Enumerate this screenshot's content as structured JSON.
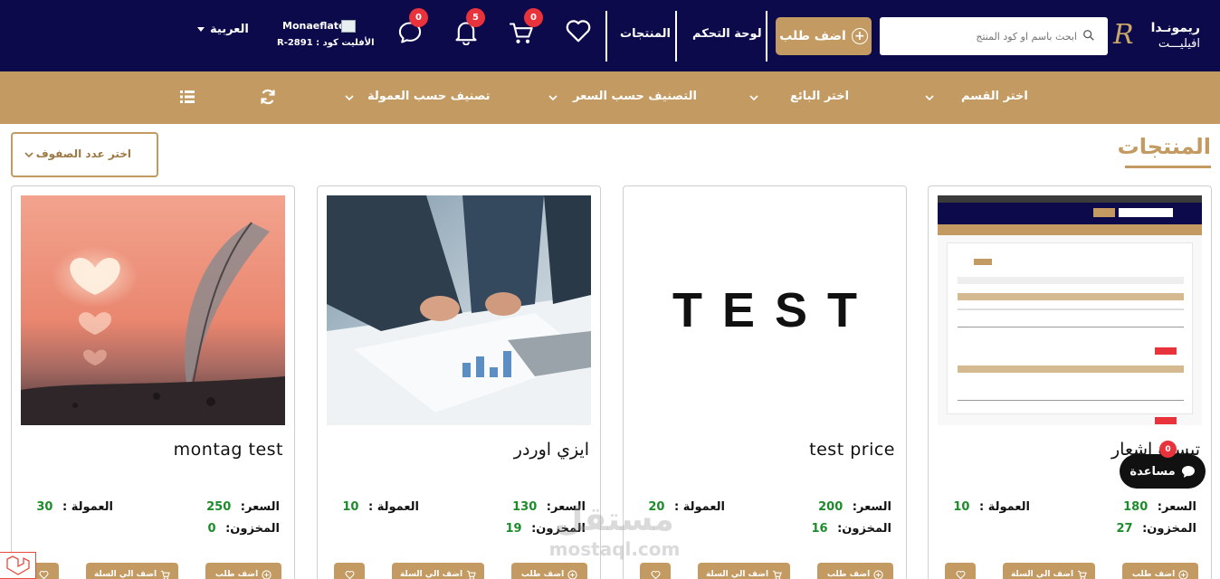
{
  "header": {
    "brand_line1": "ريمونـدا",
    "brand_line2": "افيليـــت",
    "brand_mono": "R",
    "search_placeholder": "ابحث باسم او كود المنتج",
    "add_order": "اضف طلب",
    "nav_dashboard": "لوحة التحكم",
    "nav_products": "المنتجات",
    "cart_count": "0",
    "notifications_count": "5",
    "messages_count": "0",
    "user_name": "Monaeflate",
    "user_code": "الأفليت كود : R-2891",
    "language": "العربية"
  },
  "filters": {
    "category": "اختر القسم",
    "seller": "اختر البائع",
    "price_sort": "التصنيف حسب السعر",
    "commission_sort": "تصنيف حسب العمولة"
  },
  "section": {
    "title": "المنتجات",
    "rows_select": "اختر عدد الصفوف"
  },
  "labels": {
    "price": "السعر:",
    "commission": "العمولة :",
    "stock": "المخزون:",
    "add_order_btn": "اضف طلب",
    "add_cart_btn": "اضف الي السلة"
  },
  "products": [
    {
      "name": "تيست اشعار",
      "price": "180",
      "commission": "10",
      "stock": "27",
      "image": "screenshot"
    },
    {
      "name": "test price",
      "price": "200",
      "commission": "20",
      "stock": "16",
      "image": "text",
      "image_text": "TEST"
    },
    {
      "name": "ايزي اوردر",
      "price": "130",
      "commission": "10",
      "stock": "19",
      "image": "office-photo"
    },
    {
      "name": "montag test",
      "price": "250",
      "commission": "30",
      "stock": "0",
      "image": "feather-photo"
    }
  ],
  "help": {
    "label": "مساعدة",
    "count": "0"
  },
  "watermark": {
    "line1": "مستقل",
    "line2": "mostaql.com"
  },
  "colors": {
    "navy": "#0c0a4a",
    "gold": "#c39b62",
    "badge": "#e8333c",
    "value_green": "#1d8c2a"
  }
}
